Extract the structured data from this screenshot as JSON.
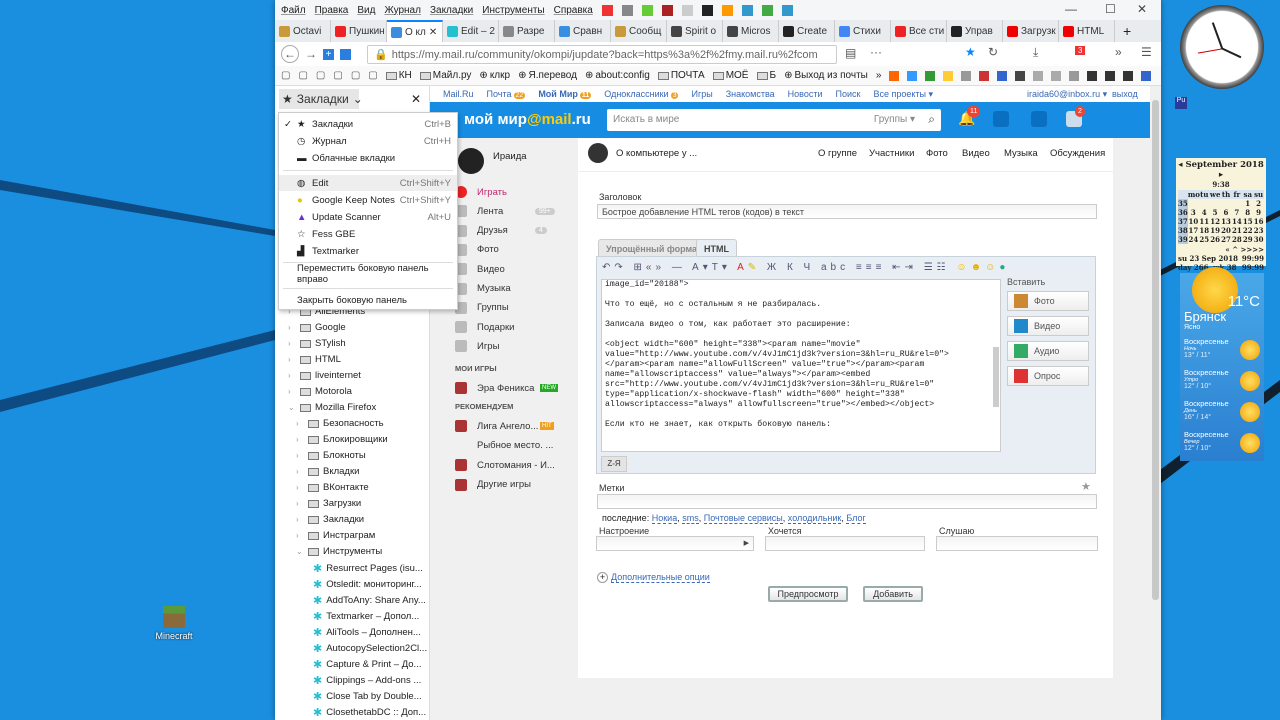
{
  "desktop": {
    "icons": [
      {
        "label": "Minecraft"
      },
      {
        "label": "Pu"
      }
    ]
  },
  "browser": {
    "menu": [
      "Файл",
      "Правка",
      "Вид",
      "Журнал",
      "Закладки",
      "Инструменты",
      "Справка"
    ],
    "menu_badges": [
      "25",
      "6"
    ],
    "tabs": [
      {
        "label": "Octavi",
        "color": "#c99a3a"
      },
      {
        "label": "Пушкин",
        "color": "#e22"
      },
      {
        "label": "О кл",
        "color": "#3a8ee0",
        "active": true
      },
      {
        "label": "Edit – 2",
        "color": "#25c0d0"
      },
      {
        "label": "Разре",
        "color": "#888"
      },
      {
        "label": "Сравн",
        "color": "#3a8ee0"
      },
      {
        "label": "Сообщ",
        "color": "#c99a3a"
      },
      {
        "label": "Spirit о",
        "color": "#444"
      },
      {
        "label": "Micros",
        "color": "#444"
      },
      {
        "label": "Create",
        "color": "#222"
      },
      {
        "label": "Стихи",
        "color": "#4285f4"
      },
      {
        "label": "Все сти",
        "color": "#e22"
      },
      {
        "label": "Управ",
        "color": "#222"
      },
      {
        "label": "Загрузк",
        "color": "#e00"
      },
      {
        "label": "HTML",
        "color": "#e00"
      }
    ],
    "url": "https://my.mail.ru/community/okompi/jupdate?back=https%3a%2f%2fmy.mail.ru%2fcom",
    "toolbar_badge": "3",
    "bookmarks": [
      {
        "label": "КН",
        "type": "folder"
      },
      {
        "label": "Майл.ру",
        "type": "folder"
      },
      {
        "label": "клкр",
        "type": "globe"
      },
      {
        "label": "Я.перевод",
        "type": "globe"
      },
      {
        "label": "about:config",
        "type": "globe"
      },
      {
        "label": "ПОЧТА",
        "type": "folder"
      },
      {
        "label": "МОЁ",
        "type": "folder"
      },
      {
        "label": "Б",
        "type": "folder"
      },
      {
        "label": "Выход из почты",
        "type": "globe"
      }
    ]
  },
  "sidebar": {
    "title": "Закладки",
    "menu": [
      {
        "label": "Закладки",
        "shortcut": "Ctrl+B",
        "checked": true
      },
      {
        "label": "Журнал",
        "shortcut": "Ctrl+H"
      },
      {
        "label": "Облачные вкладки",
        "shortcut": ""
      },
      {
        "label": "Edit",
        "shortcut": "Ctrl+Shift+Y"
      },
      {
        "label": "Google Keep Notes",
        "shortcut": "Ctrl+Shift+Y"
      },
      {
        "label": "Update Scanner",
        "shortcut": "Alt+U"
      },
      {
        "label": "Fess GBE",
        "shortcut": ""
      },
      {
        "label": "Textmarker",
        "shortcut": ""
      }
    ],
    "move_right": "Переместить боковую панель вправо",
    "close": "Закрыть боковую панель",
    "tree": [
      {
        "label": "AliElements",
        "level": 0
      },
      {
        "label": "Google",
        "level": 0
      },
      {
        "label": "STylish",
        "level": 0
      },
      {
        "label": "HTML",
        "level": 0
      },
      {
        "label": "liveinternet",
        "level": 0
      },
      {
        "label": "Motorola",
        "level": 0
      },
      {
        "label": "Mozilla Firefox",
        "level": 0,
        "open": true
      },
      {
        "label": "Безопасность",
        "level": 1
      },
      {
        "label": "Блокировщики",
        "level": 1
      },
      {
        "label": "Блокноты",
        "level": 1
      },
      {
        "label": "Вкладки",
        "level": 1
      },
      {
        "label": "ВКонтакте",
        "level": 1
      },
      {
        "label": "Загрузки",
        "level": 1
      },
      {
        "label": "Закладки",
        "level": 1
      },
      {
        "label": "Инстраграм",
        "level": 1
      },
      {
        "label": "Инструменты",
        "level": 1,
        "open": true
      }
    ],
    "bookmarks": [
      "Resurrect Pages (isu...",
      "Otsledit: мониторинг...",
      "AddToAny: Share Any...",
      "Textmarker – Допол...",
      "AliTools – Дополнен...",
      "AutocopySelection2Cl...",
      "Capture & Print – До...",
      "Clippings – Add-ons ...",
      "Close Tab by Double...",
      "ClosethetabDC :: Доп..."
    ]
  },
  "site": {
    "toplinks": [
      {
        "label": "Mail.Ru"
      },
      {
        "label": "Почта",
        "badge": "22"
      },
      {
        "label": "Мой Мир",
        "badge": "11"
      },
      {
        "label": "Одноклассники",
        "badge": "3"
      },
      {
        "label": "Игры"
      },
      {
        "label": "Знакомства"
      },
      {
        "label": "Новости"
      },
      {
        "label": "Поиск"
      },
      {
        "label": "Все проекты ▾"
      }
    ],
    "user_email": "iraida60@inbox.ru ▾",
    "logout": "выход",
    "logo": "мой мир@mail.ru",
    "logo_a": "мой мир",
    "logo_b": "@mail",
    "logo_c": ".ru",
    "search_placeholder": "Искать в мире",
    "search_scope": "Группы ▾",
    "notif_badges": {
      "bell": "11",
      "games": "2"
    },
    "profile_name": "Ираида",
    "left_menu": [
      {
        "label": "Играть",
        "badge": ""
      },
      {
        "label": "Лента",
        "badge": "99+"
      },
      {
        "label": "Друзья",
        "badge": "4"
      },
      {
        "label": "Фото"
      },
      {
        "label": "Видео"
      },
      {
        "label": "Музыка"
      },
      {
        "label": "Группы"
      },
      {
        "label": "Подарки"
      },
      {
        "label": "Игры"
      }
    ],
    "my_games_title": "МОИ ИГРЫ",
    "my_games": [
      {
        "label": "Эра Феникса",
        "badge": "NEW"
      }
    ],
    "recommended_title": "РЕКОМЕНДУЕМ",
    "recommended": [
      {
        "label": "Лига Ангело...",
        "badge": "HIT"
      },
      {
        "label": "Рыбное место. ..."
      },
      {
        "label": "Слотомания - И..."
      },
      {
        "label": "Другие игры"
      }
    ],
    "group_name": "О компьютере у ...",
    "group_nav": [
      "О группе",
      "Участники",
      "Фото",
      "Видео",
      "Музыка",
      "Обсуждения"
    ],
    "form": {
      "title_label": "Заголовок",
      "title_value": "Бострое добавление HTML тегов (кодов) в текст",
      "tab_simple": "Упрощённый формат",
      "tab_html": "HTML",
      "content_lines": [
        "image_id=\"20188\">",
        "",
        "Что то ещё, но с остальным я не разбиралась.",
        "",
        "Записала видео о том, как работает это расширение:",
        "",
        "<object width=\"600\" height=\"338\"><param name=\"movie\"",
        "value=\"http://www.youtube.com/v/4vJ1mC1jd3k?version=3&hl=ru_RU&rel=0\">",
        "</param><param name=\"allowFullScreen\" value=\"true\"></param><param",
        "name=\"allowscriptaccess\" value=\"always\"></param><embed",
        "src=\"http://www.youtube.com/v/4vJ1mC1jd3k?version=3&hl=ru_RU&rel=0\"",
        "type=\"application/x-shockwave-flash\" width=\"600\" height=\"338\"",
        "allowscriptaccess=\"always\" allowfullscreen=\"true\"></embed></object>",
        "",
        "Если кто не знает, как открыть боковую панель:"
      ],
      "insert_label": "Вставить",
      "insert": [
        "Фото",
        "Видео",
        "Аудио",
        "Опрос"
      ],
      "sort_btn": "Z-Я",
      "tags_label": "Метки",
      "recent_label": "последние:",
      "recent_tags": [
        "Нокиа",
        "sms",
        "Почтовые сервисы",
        "холодильник",
        "Блог"
      ],
      "mood_label": "Настроение",
      "want_label": "Хочется",
      "listen_label": "Слушаю",
      "more_options": "Дополнительные опции",
      "preview_btn": "Предпросмотр",
      "add_btn": "Добавить"
    }
  },
  "widgets": {
    "calendar": {
      "month": "September 2018",
      "time": "9:38",
      "weekdays": [
        "mo",
        "tu",
        "we",
        "th",
        "fr",
        "sa",
        "su"
      ],
      "weeks": [
        [
          "35",
          "",
          "",
          "",
          "",
          "",
          "1",
          "2"
        ],
        [
          "36",
          "3",
          "4",
          "5",
          "6",
          "7",
          "8",
          "9"
        ],
        [
          "37",
          "10",
          "11",
          "12",
          "13",
          "14",
          "15",
          "16"
        ],
        [
          "38",
          "17",
          "18",
          "19",
          "20",
          "21",
          "22",
          "23"
        ],
        [
          "39",
          "24",
          "25",
          "26",
          "27",
          "28",
          "29",
          "30"
        ]
      ],
      "nav": "« ^ >>>>",
      "date_line": "su 23 Sep 2018",
      "day_line": "day 266, wk 38",
      "val1": "99:99",
      "val2": "99:99"
    },
    "weather": {
      "temp": "11°C",
      "city": "Брянск",
      "cond": "Ясно",
      "forecast": [
        {
          "day": "Воскресенье",
          "part": "Ночь",
          "temps": "13° / 11°"
        },
        {
          "day": "Воскресенье",
          "part": "Утро",
          "temps": "12° / 10°"
        },
        {
          "day": "Воскресенье",
          "part": "День",
          "temps": "16° / 14°"
        },
        {
          "day": "Воскресенье",
          "part": "Вечер",
          "temps": "12° / 10°"
        }
      ]
    }
  }
}
